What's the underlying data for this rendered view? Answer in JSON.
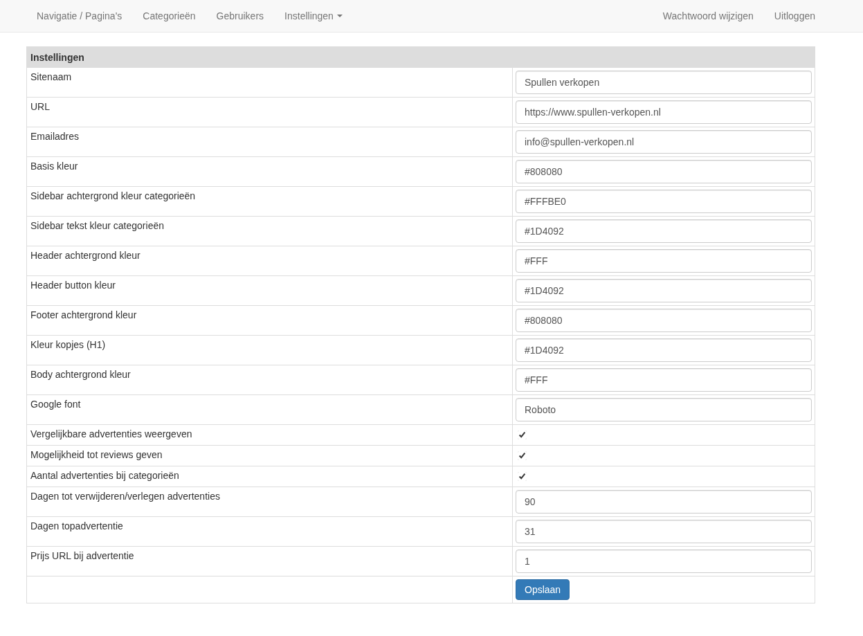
{
  "navbar": {
    "left": [
      {
        "label": "Navigatie / Pagina's",
        "dropdown": false
      },
      {
        "label": "Categorieën",
        "dropdown": false
      },
      {
        "label": "Gebruikers",
        "dropdown": false
      },
      {
        "label": "Instellingen",
        "dropdown": true
      }
    ],
    "right": [
      {
        "label": "Wachtwoord wijzigen"
      },
      {
        "label": "Uitloggen"
      }
    ]
  },
  "table": {
    "title": "Instellingen",
    "rows": [
      {
        "kind": "text",
        "label": "Sitenaam",
        "value": "Spullen verkopen"
      },
      {
        "kind": "text",
        "label": "URL",
        "value": "https://www.spullen-verkopen.nl"
      },
      {
        "kind": "text",
        "label": "Emailadres",
        "value": "info@spullen-verkopen.nl"
      },
      {
        "kind": "text",
        "label": "Basis kleur",
        "value": "#808080"
      },
      {
        "kind": "text",
        "label": "Sidebar achtergrond kleur categorieën",
        "value": "#FFFBE0"
      },
      {
        "kind": "text",
        "label": "Sidebar tekst kleur categorieën",
        "value": "#1D4092"
      },
      {
        "kind": "text",
        "label": "Header achtergrond kleur",
        "value": "#FFF"
      },
      {
        "kind": "text",
        "label": "Header button kleur",
        "value": "#1D4092"
      },
      {
        "kind": "text",
        "label": "Footer achtergrond kleur",
        "value": "#808080"
      },
      {
        "kind": "text",
        "label": "Kleur kopjes (H1)",
        "value": "#1D4092"
      },
      {
        "kind": "text",
        "label": "Body achtergrond kleur",
        "value": "#FFF"
      },
      {
        "kind": "text",
        "label": "Google font",
        "value": "Roboto"
      },
      {
        "kind": "checkbox",
        "label": "Vergelijkbare advertenties weergeven",
        "checked": true
      },
      {
        "kind": "checkbox",
        "label": "Mogelijkheid tot reviews geven",
        "checked": true
      },
      {
        "kind": "checkbox",
        "label": "Aantal advertenties bij categorieën",
        "checked": true
      },
      {
        "kind": "text",
        "label": "Dagen tot verwijderen/verlegen advertenties",
        "value": "90"
      },
      {
        "kind": "text",
        "label": "Dagen topadvertentie",
        "value": "31"
      },
      {
        "kind": "text",
        "label": "Prijs URL bij advertentie",
        "value": "1"
      }
    ],
    "submit": "Opslaan"
  }
}
